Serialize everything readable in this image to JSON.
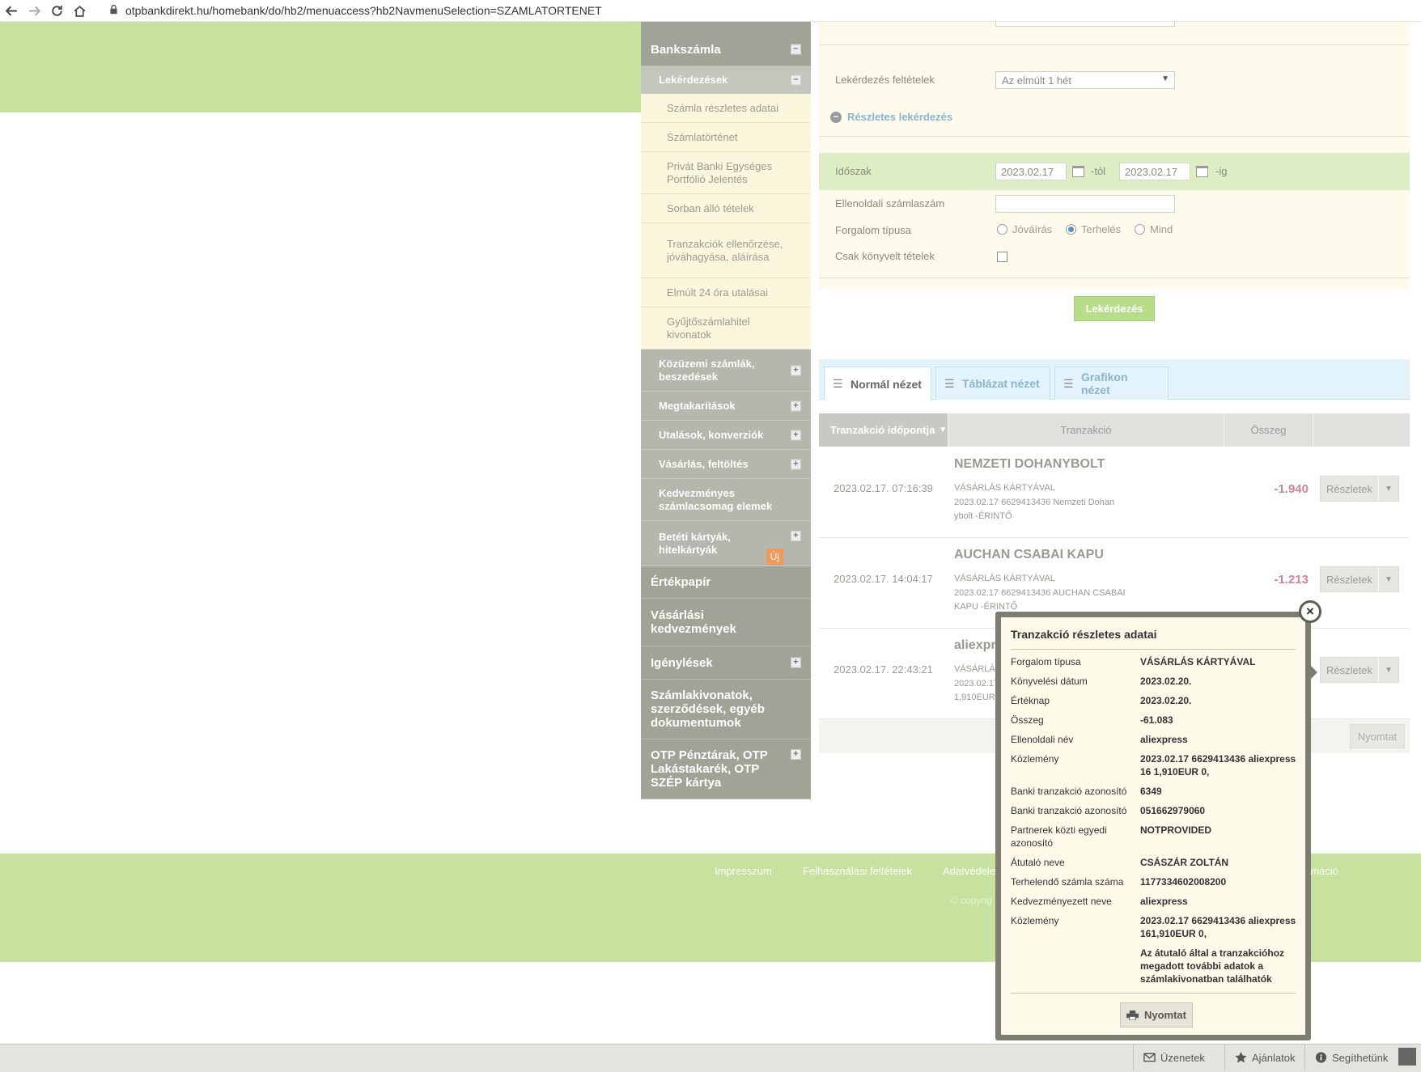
{
  "browser": {
    "url": "otpbankdirekt.hu/homebank/do/hb2/menuaccess?hb2NavmenuSelection=SZAMLATORTENET"
  },
  "sidebar": {
    "bankszamla": "Bankszámla",
    "lekerdezesek": "Lekérdezések",
    "sub": [
      "Számla részletes adatai",
      "Számlatörténet",
      "Privát Banki Egységes Portfólió Jelentés",
      "Sorban álló tételek",
      "Tranzakciók ellenőrzése, jóváhagyása, aláírása",
      "Elmúlt 24 óra utalásai",
      "Gyűjtőszámlahitel kivonatok"
    ],
    "groups": [
      "Közüzemi számlák, beszedések",
      "Megtakarítások",
      "Utalások, konverziók",
      "Vásárlás, feltöltés",
      "Kedvezményes számlacsomag elemek",
      "Betéti kártyák, hitelkártyák"
    ],
    "uj_badge": "Új",
    "top": [
      "Értékpapír",
      "Vásárlási kedvezmények",
      "Igénylések",
      "Számlakivonatok, szerződések, egyéb dokumentumok",
      "OTP Pénztárak, OTP Lakástakarék, OTP SZÉP kártya"
    ]
  },
  "query": {
    "conditions_label": "Lekérdezés feltételek",
    "conditions_value": "Az elmúlt 1 hét",
    "advanced_label": "Részletes lekérdezés",
    "period_label": "Időszak",
    "date_from": "2023.02.17",
    "from_suffix": "-tól",
    "date_to": "2023.02.17",
    "to_suffix": "-ig",
    "counter_account_label": "Ellenoldali számlaszám",
    "turnover_type_label": "Forgalom típusa",
    "radio_credit": "Jóváírás",
    "radio_debit": "Terhelés",
    "radio_all": "Mind",
    "booked_only_label": "Csak könyvelt tételek",
    "submit": "Lekérdezés"
  },
  "tabs": [
    "Normál nézet",
    "Táblázat nézet",
    "Grafikon nézet"
  ],
  "table": {
    "headers": [
      "Tranzakció időpontja",
      "Tranzakció",
      "Összeg"
    ],
    "details_label": "Részletek",
    "rows": [
      {
        "date": "2023.02.17. 07:16:39",
        "name": "NEMZETI DOHANYBOLT",
        "type": "VÁSÁRLÁS KÁRTYÁVAL",
        "desc1": "2023.02.17 6629413436 Nemzeti Dohan",
        "desc2": "ybolt -ÉRINTŐ",
        "amount": "-1.940"
      },
      {
        "date": "2023.02.17. 14:04:17",
        "name": "AUCHAN CSABAI KAPU",
        "type": "VÁSÁRLÁS KÁRTYÁVAL",
        "desc1": "2023.02.17 6629413436 AUCHAN CSABAI",
        "desc2": "KAPU -ÉRINTŐ",
        "amount": "-1.213"
      },
      {
        "date": "2023.02.17. 22:43:21",
        "name": "aliexpr",
        "type": "VÁSÁRLÁ",
        "desc1": "2023.02.17",
        "desc2": "1,910EUR",
        "amount": ""
      }
    ],
    "print_label": "Nyomtat"
  },
  "footer": {
    "links": [
      "Impresszum",
      "Felhasználási feltételek",
      "Adatvédele",
      "rmáció"
    ],
    "copyright": "© copyrig"
  },
  "popup": {
    "title": "Tranzakció részletes adatai",
    "rows": [
      {
        "label": "Forgalom típusa",
        "value": "VÁSÁRLÁS KÁRTYÁVAL"
      },
      {
        "label": "Könyvelési dátum",
        "value": "2023.02.20."
      },
      {
        "label": "Értéknap",
        "value": "2023.02.20."
      },
      {
        "label": "Összeg",
        "value": "-61.083"
      },
      {
        "label": "Ellenoldali név",
        "value": "aliexpress"
      },
      {
        "label": "Közlemény",
        "value": "2023.02.17 6629413436 aliexpress 16 1,910EUR 0,"
      },
      {
        "label": "Banki tranzakció azonosító",
        "value": "6349"
      },
      {
        "label": "Banki tranzakció azonosító",
        "value": "051662979060"
      },
      {
        "label": "Partnerek közti egyedi azonosító",
        "value": "NOTPROVIDED"
      },
      {
        "label": "Átutaló neve",
        "value": "CSÁSZÁR ZOLTÁN"
      },
      {
        "label": "Terhelendő számla száma",
        "value": "1177334602008200"
      },
      {
        "label": "Kedvezményezett neve",
        "value": "aliexpress"
      },
      {
        "label": "Közlemény",
        "value": "2023.02.17 6629413436 aliexpress 161,910EUR 0,"
      }
    ],
    "note": "Az átutaló által a tranzakcióhoz megadott további adatok a számlakivonatban találhatók",
    "print_label": "Nyomtat"
  },
  "statusbar": {
    "messages": "Üzenetek",
    "offers": "Ajánlatok",
    "help": "Segíthetünk"
  }
}
